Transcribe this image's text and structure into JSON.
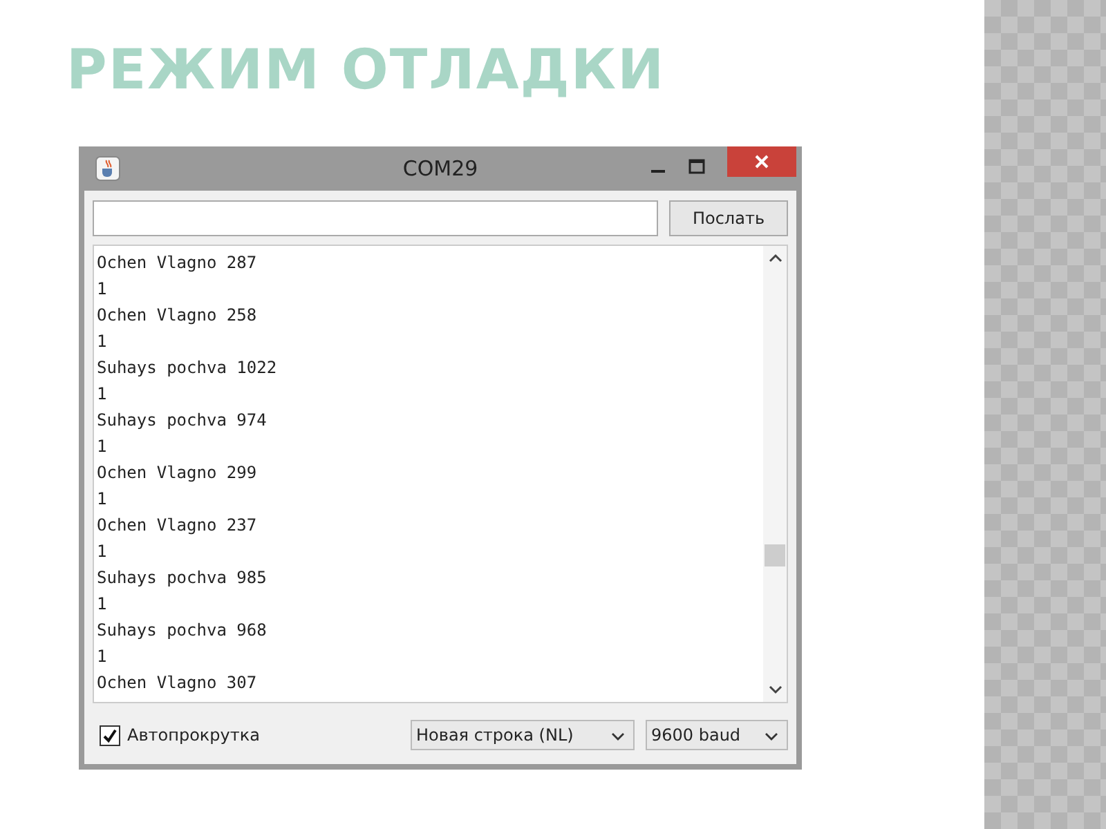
{
  "slide": {
    "title": "РЕЖИМ ОТЛАДКИ"
  },
  "window": {
    "title": "COM29"
  },
  "send_button": {
    "label": "Послать"
  },
  "output_lines": [
    "Ochen Vlagno 287",
    "1",
    "Ochen Vlagno 258",
    "1",
    "Suhays pochva 1022",
    "1",
    "Suhays pochva 974",
    "1",
    "Ochen Vlagno 299",
    "1",
    "Ochen Vlagno 237",
    "1",
    "Suhays pochva 985",
    "1",
    "Suhays pochva 968",
    "1",
    "Ochen Vlagno 307"
  ],
  "autoscroll": {
    "label": "Автопрокрутка",
    "checked": true
  },
  "line_ending": {
    "value": "Новая строка (NL)"
  },
  "baud": {
    "value": "9600 baud"
  }
}
